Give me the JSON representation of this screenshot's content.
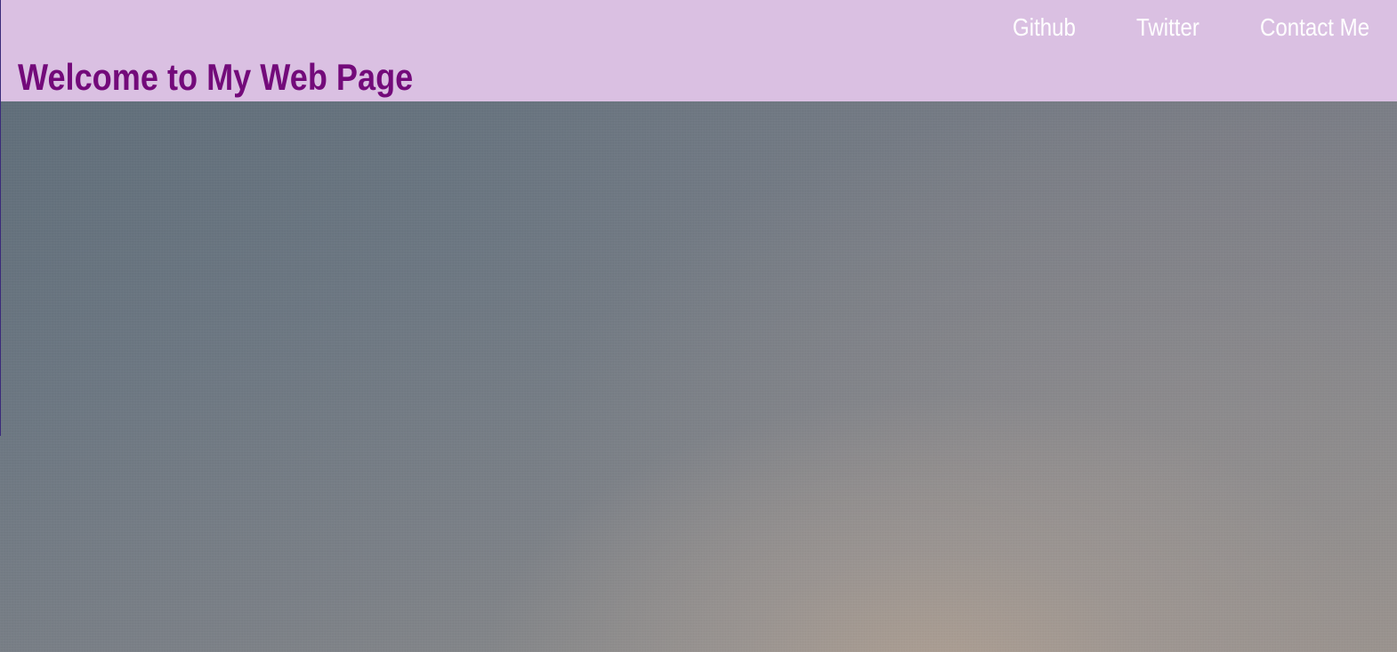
{
  "header": {
    "title": "Welcome to My Web Page",
    "nav": {
      "github": "Github",
      "twitter": "Twitter",
      "contact": "Contact Me"
    }
  },
  "colors": {
    "header_background": "#dac0e2",
    "title_color": "#730a7a",
    "nav_link_color": "#ffffff"
  },
  "hero": {
    "image_subject": "sky-background-image"
  }
}
